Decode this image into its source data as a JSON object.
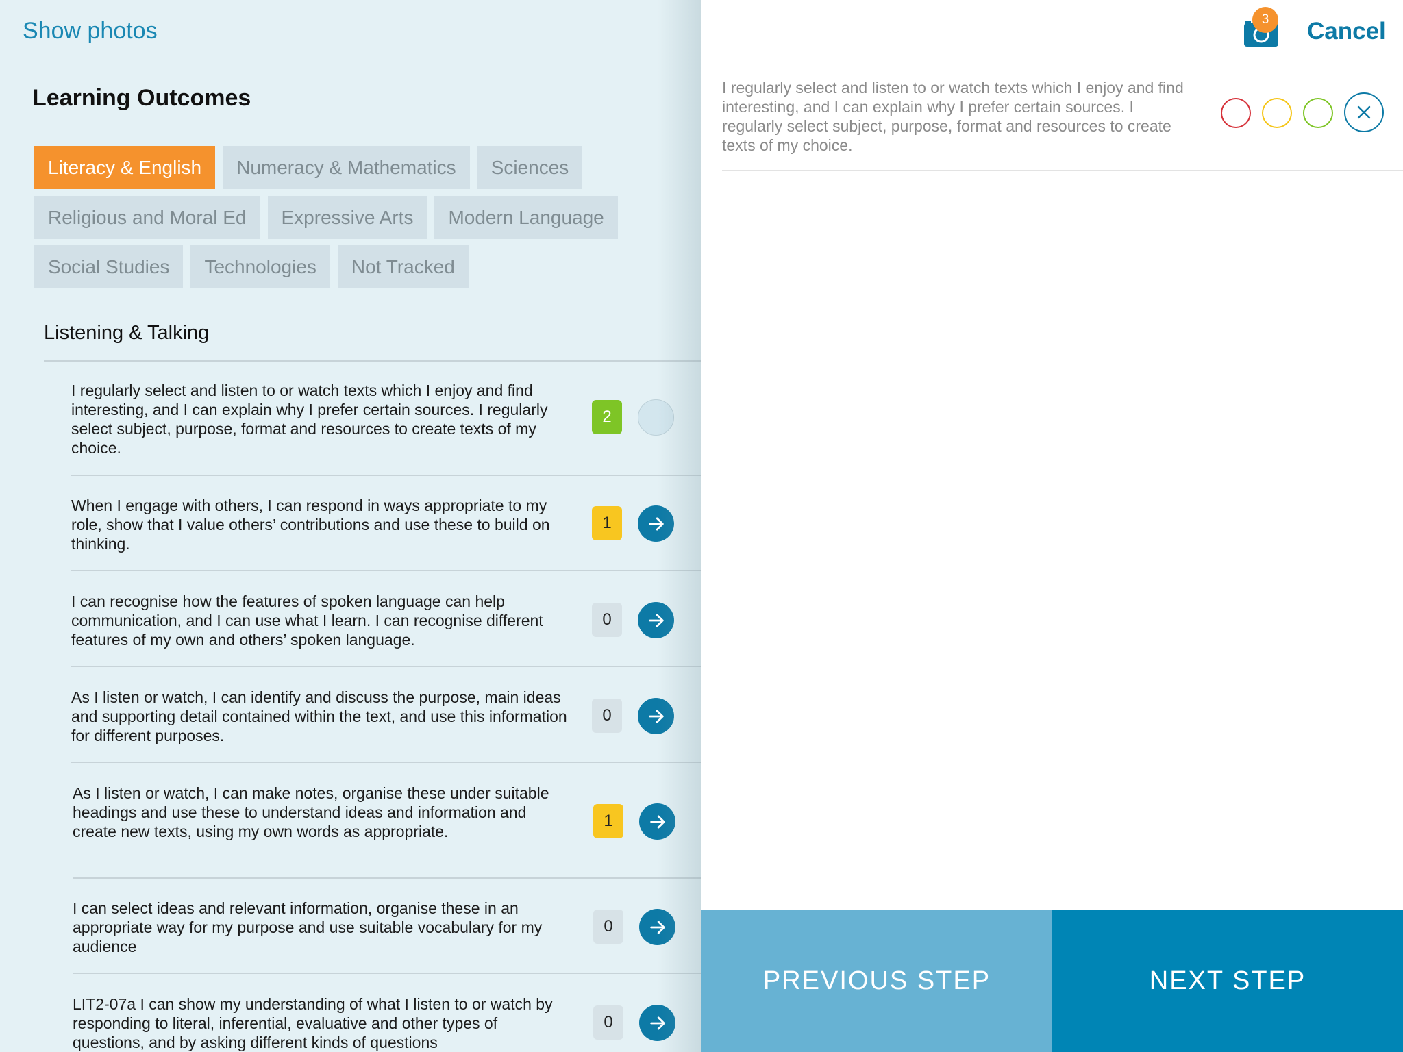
{
  "header": {
    "show_photos": "Show photos",
    "title": "Learning Outcomes"
  },
  "tabs": [
    {
      "label": "Literacy & English",
      "active": true
    },
    {
      "label": "Numeracy & Mathematics"
    },
    {
      "label": "Sciences"
    },
    {
      "label": "Religious and Moral Ed"
    },
    {
      "label": "Expressive Arts"
    },
    {
      "label": "Modern Language"
    },
    {
      "label": "Social Studies"
    },
    {
      "label": "Technologies"
    },
    {
      "label": "Not Tracked"
    }
  ],
  "section": {
    "title": "Listening & Talking"
  },
  "outcomes": [
    {
      "text": "I regularly select and listen to or watch texts which I enjoy and find interesting, and I can explain why I prefer certain sources. I regularly select subject, purpose, format and resources to create texts of my choice.",
      "count": "2",
      "badge_color": "green",
      "selected": true
    },
    {
      "text": "When I engage with others, I can respond in ways appropriate to my role, show that I value others’ contributions and use these to build on thinking.",
      "count": "1",
      "badge_color": "yellow"
    },
    {
      "text": "I can recognise how the features of spoken language can help communication, and I can use what I learn. I can recognise different features of my own and others’ spoken language.",
      "count": "0",
      "badge_color": "grey"
    },
    {
      "text": "As I listen or watch, I can identify and discuss the purpose, main ideas and supporting detail contained within the text, and use this information for different purposes.",
      "count": "0",
      "badge_color": "grey"
    },
    {
      "text": "As I listen or watch, I can make notes, organise these under suitable headings and use these to understand ideas and information and create new texts, using my own words as appropriate.",
      "count": "1",
      "badge_color": "yellow"
    },
    {
      "text": "I can select ideas and relevant information, organise these in an appropriate way for my purpose and use suitable vocabulary for my audience",
      "count": "0",
      "badge_color": "grey"
    },
    {
      "text": "LIT2-07a I can show my understanding of what I listen to or watch by responding to literal, inferential, evaluative and other types of questions, and by asking different kinds of questions",
      "count": "0",
      "badge_color": "grey"
    }
  ],
  "detail": {
    "photo_count": "3",
    "cancel": "Cancel",
    "selected_text": "I regularly select and listen to or watch texts which I enjoy and find interesting, and I can explain why I prefer certain sources. I regularly select subject, purpose, format and resources to create texts of my choice.",
    "rating_colors": [
      "#d6323a",
      "#f5c518",
      "#7ec526"
    ],
    "previous": "PREVIOUS STEP",
    "next": "NEXT STEP"
  },
  "colors": {
    "accent": "#0d7aa6",
    "active_tab": "#f5922d",
    "next_button": "#0085b5",
    "previous_button": "#67b2d3"
  }
}
